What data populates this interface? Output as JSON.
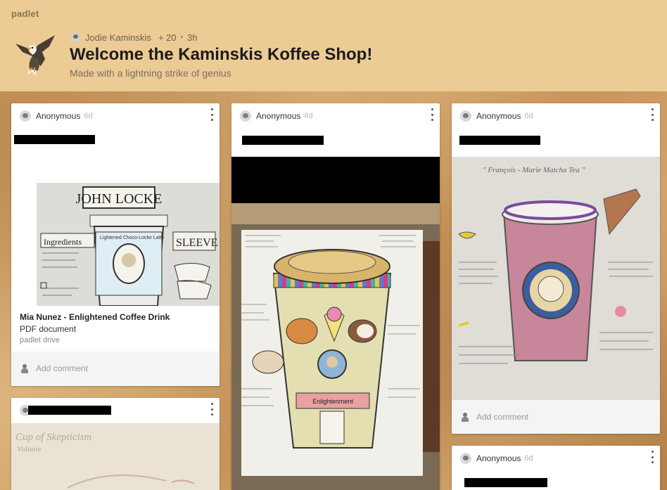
{
  "app": {
    "brand": "padlet"
  },
  "header": {
    "author": "Jodie Kaminskis",
    "likes": "+ 20",
    "time": "3h",
    "title": "Welcome the Kaminskis Koffee Shop!",
    "subtitle": "Made with a lightning strike of genius"
  },
  "posts": [
    {
      "author": "Anonymous",
      "age": "6d",
      "attachment": {
        "title": "Mia Nunez - Enlightened Coffee Drink",
        "type": "PDF document",
        "source": "padlet drive"
      },
      "image_text": {
        "name": "JOHN LOCKE",
        "sleeve": "SLEEVE",
        "ingredients": "Ingredients",
        "drink": "Lightened Choco-Locke Latte"
      },
      "comment_placeholder": "Add comment"
    },
    {
      "author": "Anonymous",
      "age": "6d",
      "image_text": {
        "badge": "Enlightenment"
      }
    },
    {
      "author": "Anonymous",
      "age": "6d",
      "image_text": {
        "caption": "\" François - Marie Matcha Tea \""
      },
      "comment_placeholder": "Add comment"
    },
    {
      "image_text": {
        "caption": "Cup of Skepticism",
        "sub": "Voltaire"
      }
    },
    {
      "author": "Anonymous",
      "age": "6d"
    }
  ],
  "colors": {
    "header_bg": "#eccb95",
    "card_bg": "#ffffff",
    "comment_bar": "#f4f4f4"
  },
  "icons": {
    "more": "kebab-menu-icon",
    "avatar": "avatar-icon",
    "comment": "person-icon",
    "logo": "eagle-logo"
  }
}
